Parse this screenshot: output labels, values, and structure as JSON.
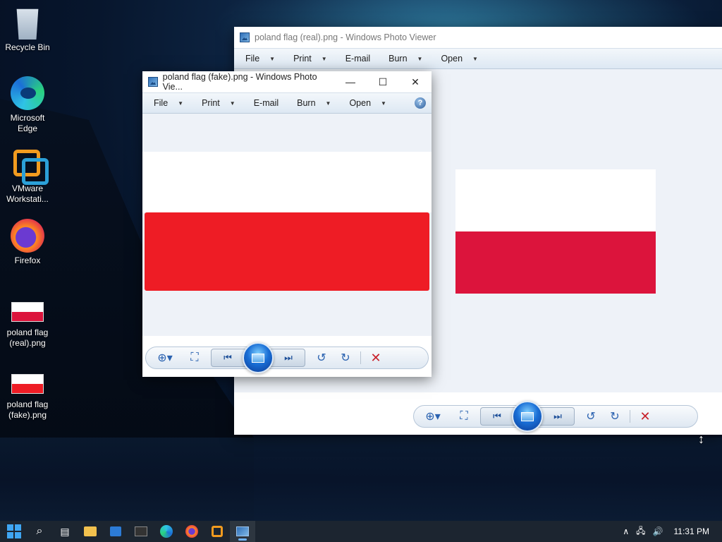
{
  "desktop": {
    "icons": [
      {
        "label": "Recycle Bin",
        "icon": "recycle-bin-icon"
      },
      {
        "label": "Microsoft\nEdge",
        "icon": "edge-icon"
      },
      {
        "label": "VMware\nWorkstati...",
        "icon": "vmware-icon"
      },
      {
        "label": "Firefox",
        "icon": "firefox-icon"
      },
      {
        "label": "poland flag\n(real).png",
        "icon": "image-file-icon"
      },
      {
        "label": "poland flag\n(fake).png",
        "icon": "image-file-icon"
      }
    ]
  },
  "window_real": {
    "title": "poland flag (real).png - Windows Photo Viewer",
    "menu": [
      "File",
      "Print",
      "E-mail",
      "Burn",
      "Open"
    ],
    "flag_colors": {
      "top": "#ffffff",
      "bottom": "#dc143c"
    }
  },
  "window_fake": {
    "title": "poland flag (fake).png - Windows Photo Vie...",
    "menu": [
      "File",
      "Print",
      "E-mail",
      "Burn",
      "Open"
    ],
    "help": "?",
    "flag_colors": {
      "top": "#ffffff",
      "bottom": "#ee1c25"
    }
  },
  "controls": {
    "min": "—",
    "max": "☐",
    "close": "✕",
    "zoom": "⊕▾",
    "fit": "⛶",
    "prev": "⏮",
    "next": "⏭",
    "rotate_ccw": "↺",
    "rotate_cw": "↻",
    "delete": "✕"
  },
  "taskbar": {
    "time": "11:31 PM",
    "tray_chevron": "∧",
    "network": "🖧",
    "volume": "🔊"
  }
}
